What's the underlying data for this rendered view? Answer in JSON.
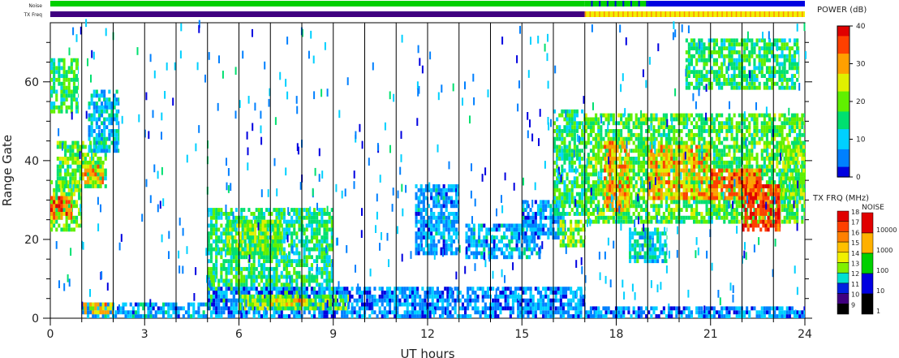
{
  "chart_data": {
    "type": "heatmap",
    "title": "",
    "xlabel": "UT hours",
    "ylabel": "Range Gate",
    "xlim": [
      0,
      24
    ],
    "ylim": [
      0,
      75
    ],
    "x_ticks": [
      0,
      3,
      6,
      9,
      12,
      15,
      18,
      21,
      24
    ],
    "y_ticks": [
      0,
      20,
      40,
      60
    ],
    "hour_gridlines": true,
    "top_bars": {
      "noise_label": "Noise",
      "txfreq_label": "TX Freq",
      "noise_segments": [
        {
          "from": 0,
          "to": 17,
          "level": 100
        },
        {
          "from": 17,
          "to": 19,
          "level": 100
        },
        {
          "from": 19,
          "to": 24,
          "level": 10
        }
      ],
      "txfreq_segments": [
        {
          "from": 0,
          "to": 17,
          "mhz": 10
        },
        {
          "from": 17,
          "to": 24,
          "mhz": 14
        }
      ]
    },
    "power_colorbar": {
      "label": "POWER (dB)",
      "min": 0,
      "max": 40,
      "ticks": [
        0,
        10,
        20,
        30,
        40
      ],
      "colors": [
        "#0000e0",
        "#0080ff",
        "#00d0ff",
        "#00e070",
        "#60f000",
        "#e0f000",
        "#ffa000",
        "#ff4000",
        "#e00000"
      ]
    },
    "txfrq_legend": {
      "label": "TX FRQ (MHz)",
      "levels": [
        {
          "value": "18",
          "color": "#e00000"
        },
        {
          "value": "17",
          "color": "#ff4000"
        },
        {
          "value": "16",
          "color": "#ff8000"
        },
        {
          "value": "15",
          "color": "#ffc000"
        },
        {
          "value": "14",
          "color": "#f0f000"
        },
        {
          "value": "13",
          "color": "#80f000"
        },
        {
          "value": "12",
          "color": "#00e0d0"
        },
        {
          "value": "11",
          "color": "#0020e0"
        },
        {
          "value": "10",
          "color": "#400080"
        },
        {
          "value": "9",
          "color": "#000000"
        }
      ]
    },
    "noise_legend": {
      "label": "NOISE",
      "levels": [
        {
          "value": "10000",
          "color": "#e00000"
        },
        {
          "value": "1000",
          "color": "#ffb000"
        },
        {
          "value": "100",
          "color": "#00d000"
        },
        {
          "value": "10",
          "color": "#0000e0"
        },
        {
          "value": "1",
          "color": "#000000"
        }
      ]
    },
    "regions": [
      {
        "t0": 0.0,
        "t1": 1.0,
        "g0": 22,
        "g1": 35,
        "power": 20
      },
      {
        "t0": 0.0,
        "t1": 0.7,
        "g0": 25,
        "g1": 31,
        "power": 34
      },
      {
        "t0": 0.2,
        "t1": 1.8,
        "g0": 33,
        "g1": 45,
        "power": 18
      },
      {
        "t0": 1.0,
        "t1": 1.7,
        "g0": 34,
        "g1": 39,
        "power": 30
      },
      {
        "t0": 1.2,
        "t1": 2.2,
        "g0": 42,
        "g1": 58,
        "power": 10
      },
      {
        "t0": 0.0,
        "t1": 0.9,
        "g0": 52,
        "g1": 66,
        "power": 16
      },
      {
        "t0": 1.0,
        "t1": 5.0,
        "g0": 0,
        "g1": 4,
        "power": 8
      },
      {
        "t0": 1.0,
        "t1": 2.0,
        "g0": 1,
        "g1": 4,
        "power": 28
      },
      {
        "t0": 5.0,
        "t1": 9.0,
        "g0": 4,
        "g1": 28,
        "power": 15
      },
      {
        "t0": 5.6,
        "t1": 7.4,
        "g0": 16,
        "g1": 25,
        "power": 20
      },
      {
        "t0": 5.0,
        "t1": 17.0,
        "g0": 0,
        "g1": 8,
        "power": 6
      },
      {
        "t0": 6.0,
        "t1": 9.5,
        "g0": 2,
        "g1": 6,
        "power": 20
      },
      {
        "t0": 7.0,
        "t1": 8.2,
        "g0": 3,
        "g1": 5,
        "power": 28
      },
      {
        "t0": 11.6,
        "t1": 13.0,
        "g0": 16,
        "g1": 34,
        "power": 7
      },
      {
        "t0": 13.2,
        "t1": 15.6,
        "g0": 15,
        "g1": 24,
        "power": 8
      },
      {
        "t0": 15.0,
        "t1": 16.4,
        "g0": 20,
        "g1": 30,
        "power": 7
      },
      {
        "t0": 16.0,
        "t1": 17.0,
        "g0": 26,
        "g1": 53,
        "power": 16
      },
      {
        "t0": 16.2,
        "t1": 17.0,
        "g0": 18,
        "g1": 25,
        "power": 20
      },
      {
        "t0": 17.0,
        "t1": 24.0,
        "g0": 24,
        "g1": 52,
        "power": 18
      },
      {
        "t0": 17.6,
        "t1": 18.4,
        "g0": 27,
        "g1": 45,
        "power": 30
      },
      {
        "t0": 19.0,
        "t1": 21.0,
        "g0": 30,
        "g1": 44,
        "power": 28
      },
      {
        "t0": 21.0,
        "t1": 22.6,
        "g0": 30,
        "g1": 38,
        "power": 33
      },
      {
        "t0": 22.0,
        "t1": 23.2,
        "g0": 22,
        "g1": 34,
        "power": 36
      },
      {
        "t0": 23.2,
        "t1": 24.0,
        "g0": 30,
        "g1": 45,
        "power": 20
      },
      {
        "t0": 18.4,
        "t1": 19.6,
        "g0": 14,
        "g1": 23,
        "power": 12
      },
      {
        "t0": 20.2,
        "t1": 23.8,
        "g0": 58,
        "g1": 71,
        "power": 16
      },
      {
        "t0": 17.0,
        "t1": 24.0,
        "g0": 0,
        "g1": 3,
        "power": 6
      }
    ]
  }
}
